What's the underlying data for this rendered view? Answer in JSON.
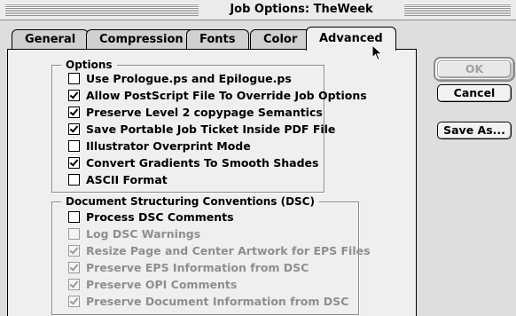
{
  "window": {
    "title": "Job Options: TheWeek"
  },
  "tabs": [
    {
      "label": "General",
      "active": false
    },
    {
      "label": "Compression",
      "active": false
    },
    {
      "label": "Fonts",
      "active": false
    },
    {
      "label": "Color",
      "active": false
    },
    {
      "label": "Advanced",
      "active": true
    }
  ],
  "options": {
    "label": "Options",
    "items": [
      {
        "label": "Use Prologue.ps and Epilogue.ps",
        "checked": false
      },
      {
        "label": "Allow PostScript File To Override Job Options",
        "checked": true
      },
      {
        "label": "Preserve Level 2 copypage Semantics",
        "checked": true
      },
      {
        "label": "Save Portable Job Ticket Inside PDF File",
        "checked": true
      },
      {
        "label": "Illustrator Overprint Mode",
        "checked": false
      },
      {
        "label": "Convert Gradients To Smooth Shades",
        "checked": true
      },
      {
        "label": "ASCII Format",
        "checked": false
      }
    ]
  },
  "dsc": {
    "label": "Document Structuring Conventions (DSC)",
    "items": [
      {
        "label": "Process DSC Comments",
        "checked": false,
        "enabled": true
      },
      {
        "label": "Log DSC Warnings",
        "checked": false,
        "enabled": false
      },
      {
        "label": "Resize Page and Center Artwork for EPS Files",
        "checked": true,
        "enabled": false
      },
      {
        "label": "Preserve EPS Information from DSC",
        "checked": true,
        "enabled": false
      },
      {
        "label": "Preserve OPI Comments",
        "checked": true,
        "enabled": false
      },
      {
        "label": "Preserve Document Information from DSC",
        "checked": true,
        "enabled": false
      }
    ]
  },
  "buttons": {
    "ok": {
      "label": "OK",
      "enabled": false
    },
    "cancel": {
      "label": "Cancel"
    },
    "save_as": {
      "label": "Save As..."
    }
  }
}
